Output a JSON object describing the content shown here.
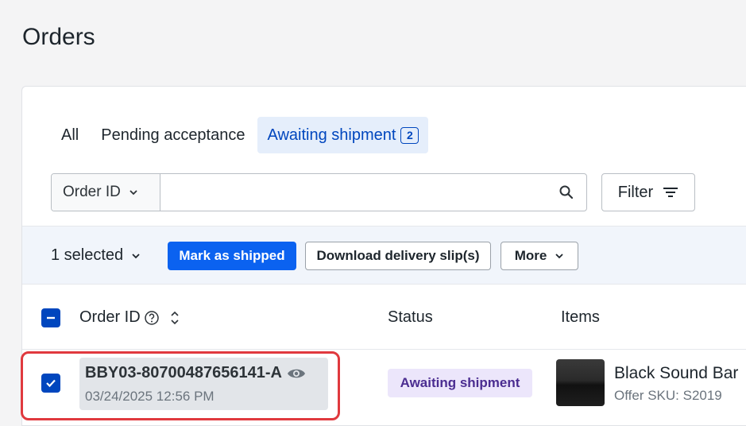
{
  "page": {
    "title": "Orders"
  },
  "tabs": [
    {
      "label": "All"
    },
    {
      "label": "Pending acceptance"
    },
    {
      "label": "Awaiting shipment",
      "badge": "2"
    }
  ],
  "search": {
    "field_label": "Order ID",
    "value": "",
    "placeholder": ""
  },
  "filter": {
    "label": "Filter"
  },
  "bulk": {
    "selected_label": "1 selected",
    "mark_shipped_label": "Mark as shipped",
    "download_label": "Download delivery slip(s)",
    "more_label": "More"
  },
  "table": {
    "headers": {
      "order_id": "Order ID",
      "status": "Status",
      "items": "Items"
    },
    "rows": [
      {
        "order_id": "BBY03-80700487656141-A",
        "date": "03/24/2025 12:56 PM",
        "status": "Awaiting shipment",
        "item_name": "Black Sound Bar",
        "item_sku": "Offer SKU: S2019",
        "selected": true
      }
    ]
  },
  "colors": {
    "accent": "#0046be",
    "primary_button": "#0b62f0",
    "status_badge_bg": "#ece6fb",
    "highlight": "#e0393e"
  }
}
